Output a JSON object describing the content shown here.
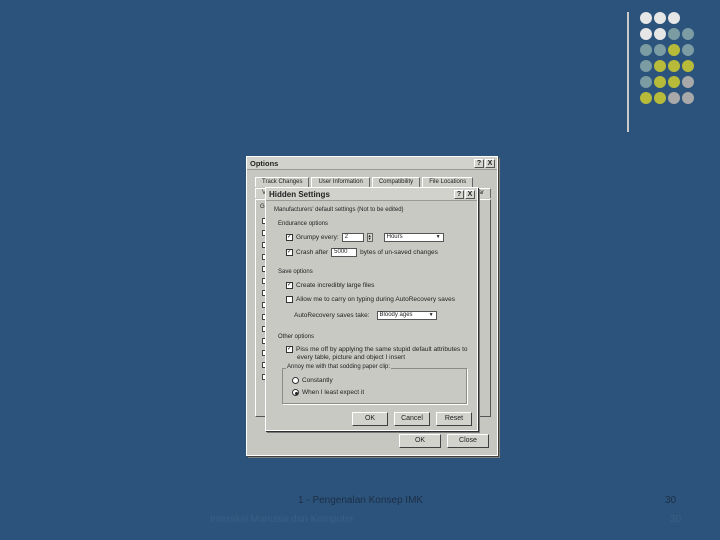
{
  "options_dialog": {
    "title": "Options",
    "help_btn": "?",
    "close_btn": "X",
    "tabs_row1": [
      "Track Changes",
      "User Information",
      "Compatibility",
      "File Locations"
    ],
    "tabs_row2": [
      "V",
      "ar"
    ],
    "general_label": "Gen",
    "ok_label": "OK",
    "cancel_label": "Close"
  },
  "hidden_dialog": {
    "title": "Hidden Settings",
    "help_btn": "?",
    "close_btn": "X",
    "subtitle": "Manufacturers' default settings  (Not to be edited)",
    "endurance": {
      "label": "Endurance options",
      "grumpy_label": "Grumpy every:",
      "grumpy_value": "2",
      "grumpy_unit": "Hours",
      "crash_label": "Crash after",
      "crash_value": "5000",
      "crash_suffix": "bytes of un-saved changes"
    },
    "save": {
      "label": "Save options",
      "opt1": "Create incredibly large files",
      "opt2": "Allow me to carry on typing during AutoRecovery saves",
      "autorecovery_label": "AutoRecovery saves take:",
      "autorecovery_value": "Bloody ages"
    },
    "other": {
      "label": "Other options",
      "opt1_line1": "Piss me off by applying the same stupid default attributes to",
      "opt1_line2": "every table, picture and object I insert",
      "annoy_label": "Annoy me with that sodding paper clip:",
      "radio1": "Constantly",
      "radio2": "When I least expect it"
    },
    "ok_label": "OK",
    "cancel_label": "Cancel",
    "reset_label": "Reset"
  },
  "footer": {
    "slide_title": "1 - Pengenalan Konsep IMK",
    "page_number": "30",
    "watermark": "Interaksi Manusia dan Komputer",
    "watermark_number": "30"
  },
  "colors": {
    "background": "#2b537c",
    "dot_white": "#e6e6e6",
    "dot_teal": "#7b9ca3",
    "dot_yellow": "#b8bb3a",
    "dot_grey": "#a9a9a9"
  }
}
